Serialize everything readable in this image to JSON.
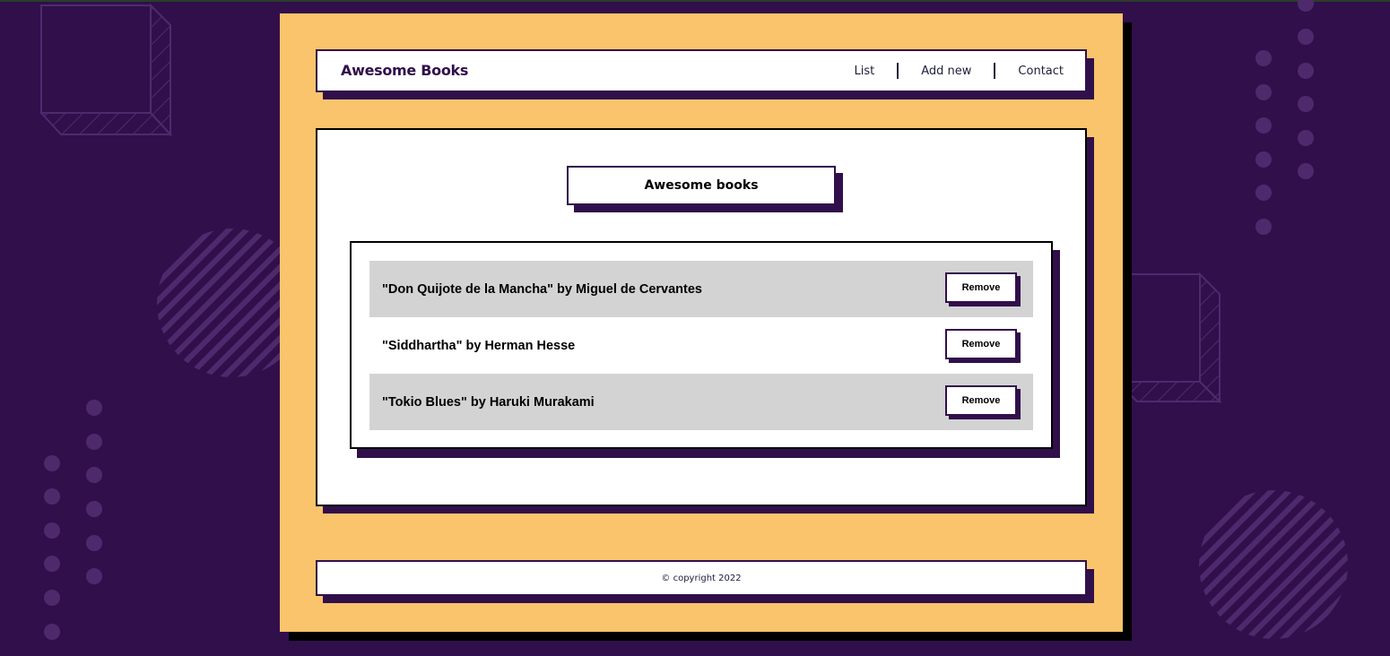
{
  "header": {
    "brand": "Awesome Books",
    "nav": [
      "List",
      "Add new",
      "Contact"
    ]
  },
  "main": {
    "title": "Awesome books",
    "books": [
      {
        "label": "\"Don Quijote de la Mancha\" by Miguel de Cervantes",
        "button": "Remove"
      },
      {
        "label": "\"Siddhartha\" by Herman Hesse",
        "button": "Remove"
      },
      {
        "label": "\"Tokio Blues\" by Haruki Murakami",
        "button": "Remove"
      }
    ]
  },
  "footer": {
    "copyright": "© copyright 2022"
  },
  "colors": {
    "background": "#310f4b",
    "wrapper": "#f9c46b",
    "accent": "#310f4b",
    "row_gray": "#d3d3d3"
  }
}
